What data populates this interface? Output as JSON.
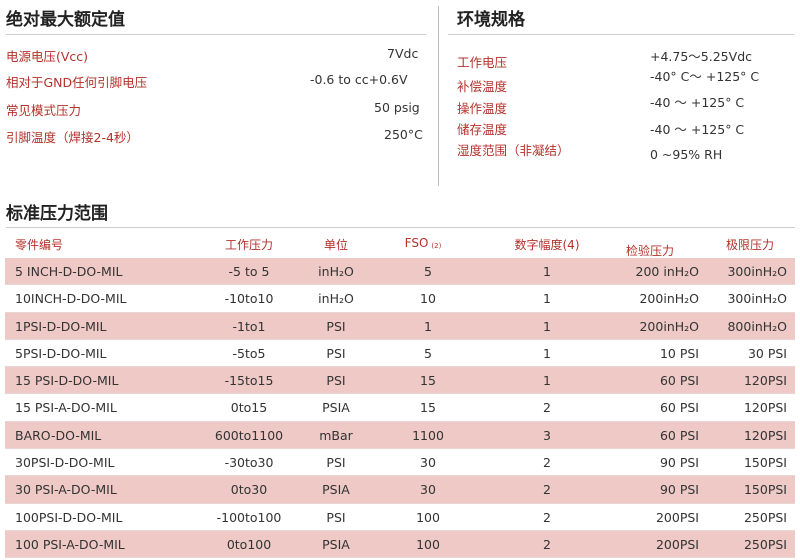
{
  "absolute_max": {
    "title": "绝对最大额定值",
    "rows": [
      {
        "label": "电源电压(Vcc)",
        "value": "7Vdc"
      },
      {
        "label": "相对于GND任何引脚电压",
        "value": "-0.6 to cc+0.6V"
      },
      {
        "label": "常见模式压力",
        "value": "50 psig"
      },
      {
        "label": "引脚温度（焊接2-4秒）",
        "value": "250°C"
      }
    ]
  },
  "environment": {
    "title": "环境规格",
    "rows": [
      {
        "label": "工作电压",
        "value": "+4.75～5.25Vdc"
      },
      {
        "label": "补偿温度",
        "value": "-40° C～ +125° C"
      },
      {
        "label": "操作温度",
        "value": "-40 ～ +125° C"
      },
      {
        "label": "储存温度",
        "value": "-40 ～ +125° C"
      },
      {
        "label": "湿度范围（非凝结）",
        "value": "0 ~95% RH"
      }
    ]
  },
  "standard_pressure": {
    "title": "标准压力范围",
    "headers": {
      "part": "零件编号",
      "range": "工作压力",
      "unit": "单位",
      "fso": "FSO",
      "fso_note": "(2)",
      "resolution": "数字幅度(4)",
      "proof": "检验压力",
      "burst": "极限压力"
    },
    "rows": [
      {
        "part": "5 INCH-D-DO-MIL",
        "range": "-5 to 5",
        "unit": "inH₂O",
        "fso": "5",
        "res": "1",
        "proof": "200  inH₂O",
        "burst": "300inH₂O"
      },
      {
        "part": "10INCH-D-DO-MIL",
        "range": "-10to10",
        "unit": "inH₂O",
        "fso": "10",
        "res": "1",
        "proof": "200inH₂O",
        "burst": "300inH₂O"
      },
      {
        "part": "1PSI-D-DO-MIL",
        "range": "-1to1",
        "unit": "PSI",
        "fso": "1",
        "res": "1",
        "proof": "200inH₂O",
        "burst": "800inH₂O"
      },
      {
        "part": "5PSI-D-DO-MIL",
        "range": "-5to5",
        "unit": "PSI",
        "fso": "5",
        "res": "1",
        "proof": "10 PSI",
        "burst": "30 PSI"
      },
      {
        "part": "15 PSI-D-DO-MIL",
        "range": "-15to15",
        "unit": "PSI",
        "fso": "15",
        "res": "1",
        "proof": "60 PSI",
        "burst": "120PSI"
      },
      {
        "part": "15 PSI-A-DO-MIL",
        "range": "0to15",
        "unit": "PSIA",
        "fso": "15",
        "res": "2",
        "proof": "60 PSI",
        "burst": "120PSI"
      },
      {
        "part": "BARO-DO-MIL",
        "range": "600to1100",
        "unit": "mBar",
        "fso": "1100",
        "res": "3",
        "proof": "60 PSI",
        "burst": "120PSI"
      },
      {
        "part": "30PSI-D-DO-MIL",
        "range": "-30to30",
        "unit": "PSI",
        "fso": "30",
        "res": "2",
        "proof": "90 PSI",
        "burst": "150PSI"
      },
      {
        "part": "30 PSI-A-DO-MIL",
        "range": "0to30",
        "unit": "PSIA",
        "fso": "30",
        "res": "2",
        "proof": "90 PSI",
        "burst": "150PSI"
      },
      {
        "part": "100PSI-D-DO-MIL",
        "range": "-100to100",
        "unit": "PSI",
        "fso": "100",
        "res": "2",
        "proof": "200PSI",
        "burst": "250PSI"
      },
      {
        "part": "100 PSI-A-DO-MIL",
        "range": "0to100",
        "unit": "PSIA",
        "fso": "100",
        "res": "2",
        "proof": "200PSI",
        "burst": "250PSI"
      }
    ],
    "shaded_rows": [
      0,
      2,
      4,
      6,
      8,
      10
    ]
  },
  "colors": {
    "label_red": "#b3322a",
    "row_shade": "#efc9c6",
    "title_text": "#222222"
  }
}
